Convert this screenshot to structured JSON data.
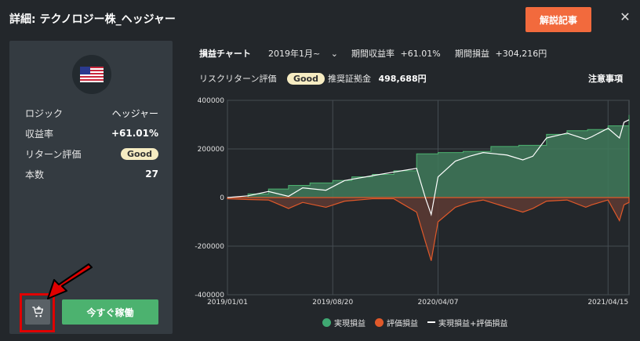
{
  "header": {
    "title": "詳細: テクノロジー株_ヘッジャー",
    "explain_button": "解説記事",
    "close_icon": "close-icon"
  },
  "left_panel": {
    "flag_icon": "us-flag-icon",
    "rows": [
      {
        "label": "ロジック",
        "value": "ヘッジャー"
      },
      {
        "label": "収益率",
        "value": "+61.01%"
      },
      {
        "label": "リターン評価",
        "value": "Good"
      },
      {
        "label": "本数",
        "value": "27"
      }
    ],
    "cart_icon": "add-to-cart-icon",
    "run_button": "今すぐ稼働"
  },
  "chart_header": {
    "title": "損益チャート",
    "period": "2019年1月~",
    "return_label": "期間収益率",
    "return_value": "+61.01%",
    "profit_label": "期間損益",
    "profit_value": "+304,216円",
    "risk_label": "リスクリターン評価",
    "risk_value": "Good",
    "margin_label": "推奨証拠金",
    "margin_value": "498,688円",
    "notes_link": "注意事項"
  },
  "colors": {
    "accent_orange": "#f26a3d",
    "green": "#4cb26f",
    "realized": "#3fa872",
    "unrealized": "#e0592a",
    "badge": "#f6ecc2"
  },
  "chart_data": {
    "type": "area",
    "title": "",
    "xlabel": "",
    "ylabel": "",
    "x_ticks": [
      "2019/01/01",
      "2019/08/20",
      "2020/04/07",
      "2021/04/15"
    ],
    "y_ticks": [
      "400000",
      "200000",
      "0",
      "-200000",
      "-400000"
    ],
    "ylim": [
      -400000,
      400000
    ],
    "xlim": [
      "2019/01/01",
      "2021/05/31"
    ],
    "grid": true,
    "legend_position": "bottom",
    "series": [
      {
        "name": "実現損益",
        "type": "step-area",
        "color": "#3fa872",
        "x": [
          "2019/01/01",
          "2019/02/15",
          "2019/04/01",
          "2019/05/15",
          "2019/07/01",
          "2019/08/20",
          "2019/10/01",
          "2019/11/15",
          "2020/01/01",
          "2020/02/10",
          "2020/02/20",
          "2020/04/07",
          "2020/06/01",
          "2020/08/01",
          "2020/10/01",
          "2020/12/01",
          "2021/01/15",
          "2021/03/01",
          "2021/04/15",
          "2021/05/31"
        ],
        "values": [
          0,
          15000,
          35000,
          50000,
          60000,
          70000,
          85000,
          95000,
          110000,
          110000,
          180000,
          185000,
          190000,
          210000,
          215000,
          260000,
          275000,
          280000,
          295000,
          340000
        ]
      },
      {
        "name": "評価損益",
        "type": "area",
        "color": "#e0592a",
        "x": [
          "2019/01/01",
          "2019/02/15",
          "2019/04/01",
          "2019/05/15",
          "2019/06/15",
          "2019/08/05",
          "2019/09/15",
          "2019/11/15",
          "2020/01/01",
          "2020/02/20",
          "2020/03/10",
          "2020/03/23",
          "2020/04/07",
          "2020/05/15",
          "2020/06/15",
          "2020/07/15",
          "2020/09/05",
          "2020/10/10",
          "2020/11/01",
          "2020/12/01",
          "2021/01/15",
          "2021/02/25",
          "2021/03/10",
          "2021/04/15",
          "2021/05/10",
          "2021/05/20",
          "2021/05/31"
        ],
        "values": [
          -5000,
          -8000,
          -10000,
          -45000,
          -20000,
          -40000,
          -15000,
          -5000,
          -5000,
          -60000,
          -180000,
          -260000,
          -100000,
          -40000,
          -20000,
          -10000,
          -40000,
          -60000,
          -45000,
          -15000,
          -10000,
          -40000,
          -30000,
          -10000,
          -95000,
          -30000,
          -20000
        ]
      },
      {
        "name": "実現損益+評価損益",
        "type": "line",
        "color": "#ffffff",
        "x": [
          "2019/01/01",
          "2019/02/15",
          "2019/04/01",
          "2019/05/15",
          "2019/06/15",
          "2019/08/05",
          "2019/09/15",
          "2019/11/15",
          "2020/01/01",
          "2020/02/20",
          "2020/03/10",
          "2020/03/23",
          "2020/04/07",
          "2020/05/15",
          "2020/06/15",
          "2020/07/15",
          "2020/09/05",
          "2020/10/10",
          "2020/11/01",
          "2020/12/01",
          "2021/01/15",
          "2021/02/25",
          "2021/03/10",
          "2021/04/15",
          "2021/05/10",
          "2021/05/20",
          "2021/05/31"
        ],
        "values": [
          0,
          7000,
          25000,
          5000,
          40000,
          30000,
          70000,
          90000,
          105000,
          120000,
          0,
          -70000,
          85000,
          150000,
          170000,
          185000,
          175000,
          155000,
          170000,
          245000,
          265000,
          240000,
          250000,
          285000,
          245000,
          310000,
          320000
        ]
      }
    ]
  }
}
